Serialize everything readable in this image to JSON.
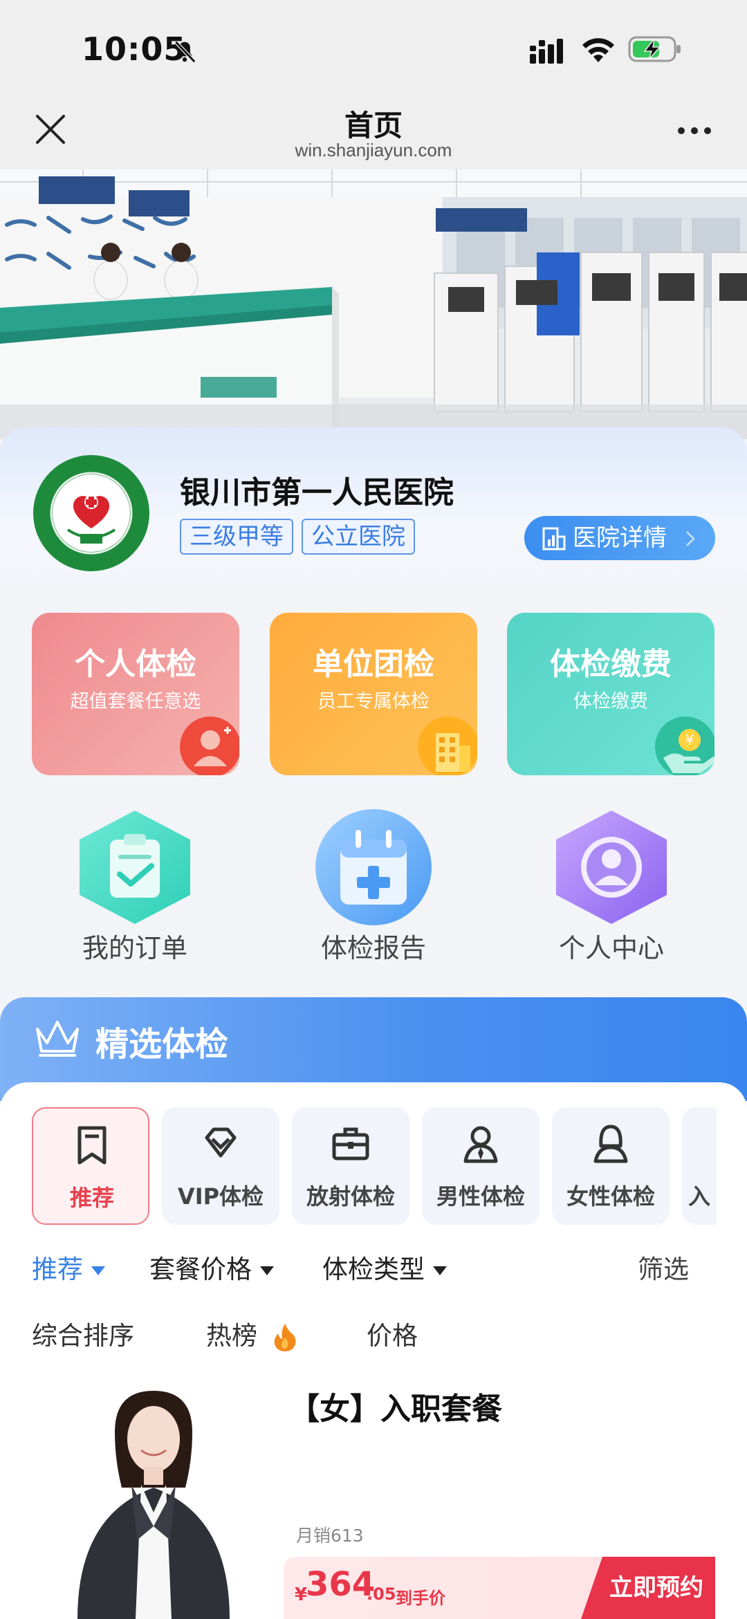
{
  "status_bar": {
    "time": "10:05"
  },
  "nav": {
    "title": "首页",
    "url": "win.shanjiayun.com"
  },
  "hospital": {
    "name": "银川市第一人民医院",
    "tags": [
      "三级甲等",
      "公立医院"
    ],
    "detail_button": "医院详情"
  },
  "services": [
    {
      "title": "个人体检",
      "subtitle": "超值套餐任意选",
      "icon": "person-icon"
    },
    {
      "title": "单位团检",
      "subtitle": "员工专属体检",
      "icon": "building-icon"
    },
    {
      "title": "体检缴费",
      "subtitle": "体检缴费",
      "icon": "payment-icon"
    }
  ],
  "quick_links": [
    {
      "label": "我的订单",
      "icon": "clipboard-check-icon"
    },
    {
      "label": "体检报告",
      "icon": "calendar-cross-icon"
    },
    {
      "label": "个人中心",
      "icon": "user-hexagon-icon"
    }
  ],
  "featured": {
    "title": "精选体检",
    "categories": [
      {
        "label": "推荐",
        "active": true
      },
      {
        "label": "VIP体检",
        "active": false
      },
      {
        "label": "放射体检",
        "active": false
      },
      {
        "label": "男性体检",
        "active": false
      },
      {
        "label": "女性体检",
        "active": false
      },
      {
        "label": "入",
        "active": false
      }
    ],
    "filters": [
      "推荐",
      "套餐价格",
      "体检类型"
    ],
    "filter_screen": "筛选",
    "sort": [
      "综合排序",
      "热榜",
      "价格"
    ]
  },
  "product": {
    "title": "【女】入职套餐",
    "sales": "月销613",
    "currency": "¥",
    "price_main": "364",
    "price_decimal": ".05",
    "price_label": "到手价",
    "book_button": "立即预约"
  },
  "colors": {
    "accent": "#3a82e6",
    "price_red": "#e8374a",
    "active_tab": "#e8414f"
  }
}
